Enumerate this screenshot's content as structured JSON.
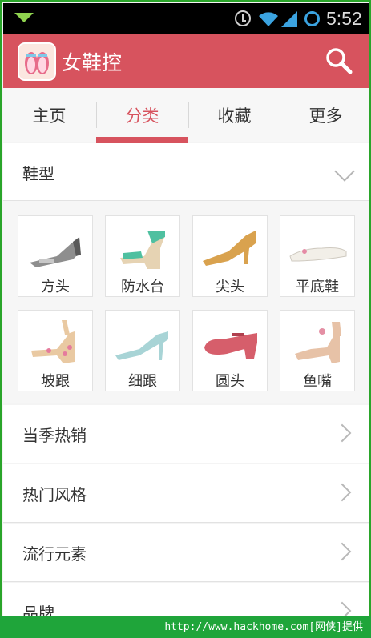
{
  "status_bar": {
    "time": "5:52",
    "icons": [
      "notification-icon",
      "alarm-icon",
      "wifi-icon",
      "signal-icon",
      "battery-icon"
    ]
  },
  "app_bar": {
    "title": "女鞋控",
    "search_icon": "search-icon",
    "color": "#d7535e"
  },
  "tabs": [
    {
      "label": "主页",
      "active": false
    },
    {
      "label": "分类",
      "active": true
    },
    {
      "label": "收藏",
      "active": false
    },
    {
      "label": "更多",
      "active": false
    }
  ],
  "shoe_type_section": {
    "title": "鞋型",
    "items": [
      {
        "label": "方头"
      },
      {
        "label": "防水台"
      },
      {
        "label": "尖头"
      },
      {
        "label": "平底鞋"
      },
      {
        "label": "坡跟"
      },
      {
        "label": "细跟"
      },
      {
        "label": "圆头"
      },
      {
        "label": "鱼嘴"
      }
    ]
  },
  "list": [
    {
      "label": "当季热销"
    },
    {
      "label": "热门风格"
    },
    {
      "label": "流行元素"
    },
    {
      "label": "品牌"
    }
  ],
  "watermark": "http://www.hackhome.com[网侠]提供"
}
